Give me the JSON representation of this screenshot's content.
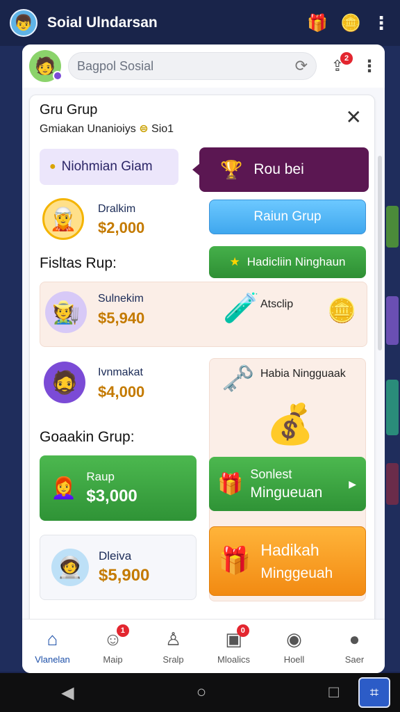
{
  "app": {
    "title": "Soial Ulndarsan"
  },
  "colors": {
    "bg": "#1a2550",
    "accent_purple": "#5b1752",
    "green": "#2f9336",
    "orange": "#f28a12",
    "blue": "#3fa7ee"
  },
  "topbar": {
    "avatar_icon": "avatar-icon",
    "gift_icon": "gift-icon",
    "coins_icon": "coins-icon",
    "menu_icon": "more-vert-icon"
  },
  "search": {
    "placeholder": "Bagpol Sosial",
    "share_badge": "2"
  },
  "card": {
    "title": "Gru Grup",
    "subtitle": "Gmiakan Unanioiys",
    "subtitle_coin": "Sio1",
    "left_pill": "Niohmian Giam",
    "dark_pill": "Rou bei",
    "member1": {
      "name": "Dralkim",
      "amount": "$2,000"
    },
    "btn_blue": "Raiun Grup",
    "btn_green": "Hadicliin Ninghaun",
    "section1": "Fisltas Rup:",
    "member2": {
      "name": "Sulnekim",
      "amount": "$5,940"
    },
    "peach_label": "Atsclip",
    "member3": {
      "name": "Ivnmakat",
      "amount": "$4,000"
    },
    "right_tile_label": "Habia Ningguaak",
    "section2": "Goaakin Grup:",
    "member4": {
      "name": "Raup",
      "amount": "$3,000"
    },
    "sonleft": {
      "line1": "Sonlest",
      "line2": "Mingueuan"
    },
    "member5": {
      "name": "Dleiva",
      "amount": "$5,900"
    },
    "orange": {
      "line1": "Hadikah",
      "line2": "Minggeuah"
    }
  },
  "nav": {
    "items": [
      {
        "label": "Vlanelan",
        "icon": "home-icon",
        "badge": ""
      },
      {
        "label": "Maip",
        "icon": "face-icon",
        "badge": "1"
      },
      {
        "label": "Sralp",
        "icon": "person-icon",
        "badge": ""
      },
      {
        "label": "Mloalics",
        "icon": "message-icon",
        "badge": "0"
      },
      {
        "label": "Hoell",
        "icon": "globe-icon",
        "badge": ""
      },
      {
        "label": "Saer",
        "icon": "user-icon",
        "badge": ""
      }
    ]
  }
}
